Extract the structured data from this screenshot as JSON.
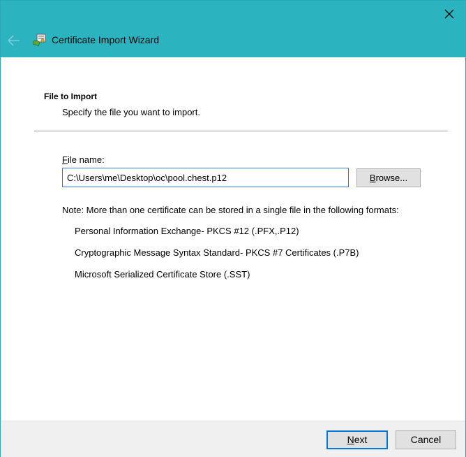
{
  "window": {
    "title": "Certificate Import Wizard",
    "close_icon": "close-icon",
    "back_icon": "back-arrow-icon",
    "wizard_icon": "certificate-icon",
    "colors": {
      "header": "#2bb3c0",
      "accent": "#0078d7",
      "footer": "#f0f0f0"
    }
  },
  "page": {
    "heading": "File to Import",
    "subheading": "Specify the file you want to import."
  },
  "file": {
    "label_mnemonic": "F",
    "label_rest": "ile name:",
    "value": "C:\\Users\\me\\Desktop\\oc\\pool.chest.p12",
    "browse_mnemonic": "B",
    "browse_rest": "rowse..."
  },
  "note": {
    "text": "Note:  More than one certificate can be stored in a single file in the following formats:",
    "formats": [
      "Personal Information Exchange- PKCS #12 (.PFX,.P12)",
      "Cryptographic Message Syntax Standard- PKCS #7 Certificates (.P7B)",
      "Microsoft Serialized Certificate Store (.SST)"
    ]
  },
  "footer": {
    "next_mnemonic": "N",
    "next_rest": "ext",
    "cancel_label": "Cancel"
  }
}
